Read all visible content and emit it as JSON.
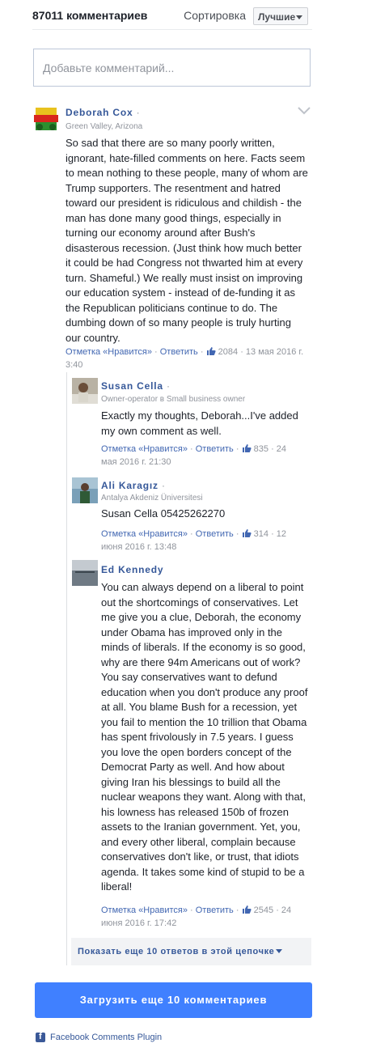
{
  "header": {
    "count": "87011",
    "count_label": "комментариев",
    "sort_label": "Сортировка",
    "sort_value": "Лучшие"
  },
  "compose": {
    "placeholder": "Добавьте комментарий..."
  },
  "comments": [
    {
      "author": "Deborah Cox",
      "dot": "·",
      "subtitle": "Green Valley, Arizona",
      "text": "So sad that there are so many poorly written, ignorant, hate-filled comments on here. Facts seem to mean nothing to these people, many of whom are Trump supporters. The resentment and hatred toward our president is ridiculous and childish - the man has done many good things, especially in turning our economy around after Bush's disasterous recession. (Just think how much better it could be had Congress not thwarted him at every turn. Shameful.) We really must insist on improving our education system - instead of de-funding it as the Republican politicians continue to do. The dumbing down of so many people is truly hurting our country.",
      "like_label": "Отметка «Нравится»",
      "reply_label": "Ответить",
      "sep": "·",
      "likes": "2084",
      "time": "13 мая 2016 г. 3:40"
    }
  ],
  "replies": [
    {
      "author": "Susan Cella",
      "dot": "·",
      "subtitle": "Owner-operator в Small business owner",
      "text": "Exactly my thoughts, Deborah...I've added my own comment as well.",
      "like_label": "Отметка «Нравится»",
      "reply_label": "Ответить",
      "sep": "·",
      "likes": "835",
      "time": "24 мая 2016 г. 21:30"
    },
    {
      "author": "Ali Karagız",
      "dot": "·",
      "subtitle": "Antalya Akdeniz Üniversitesi",
      "text": "Susan Cella 05425262270",
      "like_label": "Отметка «Нравится»",
      "reply_label": "Ответить",
      "sep": "·",
      "likes": "314",
      "time": "12 июня 2016 г. 13:48"
    },
    {
      "author": "Ed Kennedy",
      "text": "You can always depend on a liberal to point out the shortcomings of conservatives. Let me give you a clue, Deborah, the economy under Obama has improved only in the minds of liberals. If the economy is so good, why are there 94m Americans out of work? You say conservatives want to defund education when you don't produce any proof at all. You blame Bush for a recession, yet you fail to mention the 10 trillion that Obama has spent frivolously in 7.5 years. I guess you love the open borders concept of the Democrat Party as well. And how about giving Iran his blessings to build all the nuclear weapons they want. Along with that, his lowness has released 150b of frozen assets to the Iranian government. Yet, you, and every other liberal, complain because conservatives don't like, or trust, that idiots agenda. It takes some kind of stupid to be a liberal!",
      "like_label": "Отметка «Нравится»",
      "reply_label": "Ответить",
      "sep": "·",
      "likes": "2545",
      "time": "24 июня 2016 г. 17:42"
    }
  ],
  "more_replies": "Показать еще 10 ответов в этой цепочке",
  "load_more": "Загрузить еще 10 комментариев",
  "footer": "Facebook Comments Plugin",
  "colors": {
    "link": "#365899",
    "button": "#4080ff",
    "muted": "#90949c"
  },
  "icons": [
    "chevron-down-icon",
    "thumbs-up-icon",
    "facebook-icon",
    "caret-down-icon"
  ]
}
